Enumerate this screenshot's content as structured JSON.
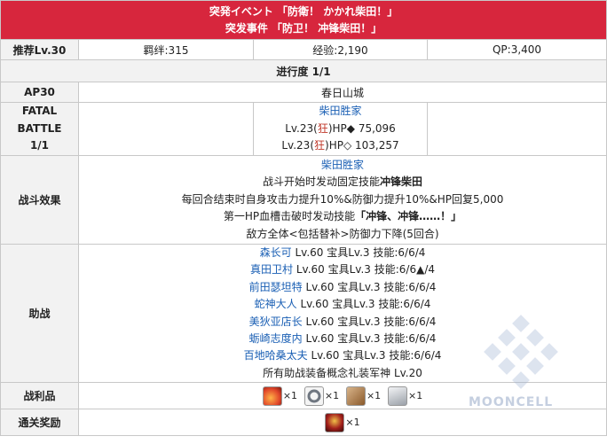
{
  "header": {
    "title_jp": "突発イベント 「防衛！ かかれ柴田！」",
    "title_cn": "突发事件 「防卫！ 冲锋柴田！」"
  },
  "stats": {
    "level_label": "推荐Lv.30",
    "bond": "羁绊:315",
    "exp": "经验:2,190",
    "qp": "QP:3,400"
  },
  "progress": "进行度 1/1",
  "ap": {
    "label": "AP30",
    "location": "春日山城"
  },
  "battle": {
    "label_lines": [
      "FATAL",
      "BATTLE",
      "1/1"
    ],
    "enemy_name": "柴田胜家",
    "enemies": [
      {
        "prefix": "Lv.23(",
        "cls": "狂",
        "suffix": ")HP◆ 75,096"
      },
      {
        "prefix": "Lv.23(",
        "cls": "狂",
        "suffix": ")HP◇ 103,257"
      }
    ]
  },
  "effects": {
    "label": "战斗效果",
    "name": "柴田胜家",
    "line1_pre": "战斗开始时发动固定技能",
    "line1_bold": "冲锋柴田",
    "line2": "每回合结束时自身攻击力提升10%&防御力提升10%&HP回复5,000",
    "line3_pre": "第一HP血槽击破时发动技能",
    "line3_bold": "「冲锋、冲锋……！」",
    "line4": "敌方全体<包括替补>防御力下降(5回合)"
  },
  "support": {
    "label": "助战",
    "members": [
      {
        "name": "森长可",
        "info": " Lv.60 宝具Lv.3 技能:6/6/4"
      },
      {
        "name": "真田卫村",
        "info": " Lv.60 宝具Lv.3 技能:6/6▲/4"
      },
      {
        "name": "前田瑟坦特",
        "info": " Lv.60 宝具Lv.3 技能:6/6/4"
      },
      {
        "name": "蛇神大人",
        "info": " Lv.60 宝具Lv.3 技能:6/6/4"
      },
      {
        "name": "美狄亚店长",
        "info": " Lv.60 宝具Lv.3 技能:6/6/4"
      },
      {
        "name": "蛎崎志度内",
        "info": " Lv.60 宝具Lv.3 技能:6/6/4"
      },
      {
        "name": "百地哈桑太夫",
        "info": " Lv.60 宝具Lv.3 技能:6/6/4"
      }
    ],
    "footer": "所有助战装备概念礼装军神 Lv.20"
  },
  "loot": {
    "label": "战利品",
    "items": [
      {
        "icon": "fire-feather-icon",
        "count": "×1",
        "color": "#e0452a"
      },
      {
        "icon": "chain-ring-icon",
        "count": "×1",
        "color": "#8a8f96"
      },
      {
        "icon": "claw-icon",
        "count": "×1",
        "color": "#8a5a2b"
      },
      {
        "icon": "silver-statue-icon",
        "count": "×1",
        "color": "#c9ccd1"
      }
    ]
  },
  "reward": {
    "label": "通关奖励",
    "items": [
      {
        "icon": "servant-portrait-icon",
        "count": "×1",
        "color": "#a3201c"
      }
    ]
  },
  "watermark": "MOONCELL"
}
